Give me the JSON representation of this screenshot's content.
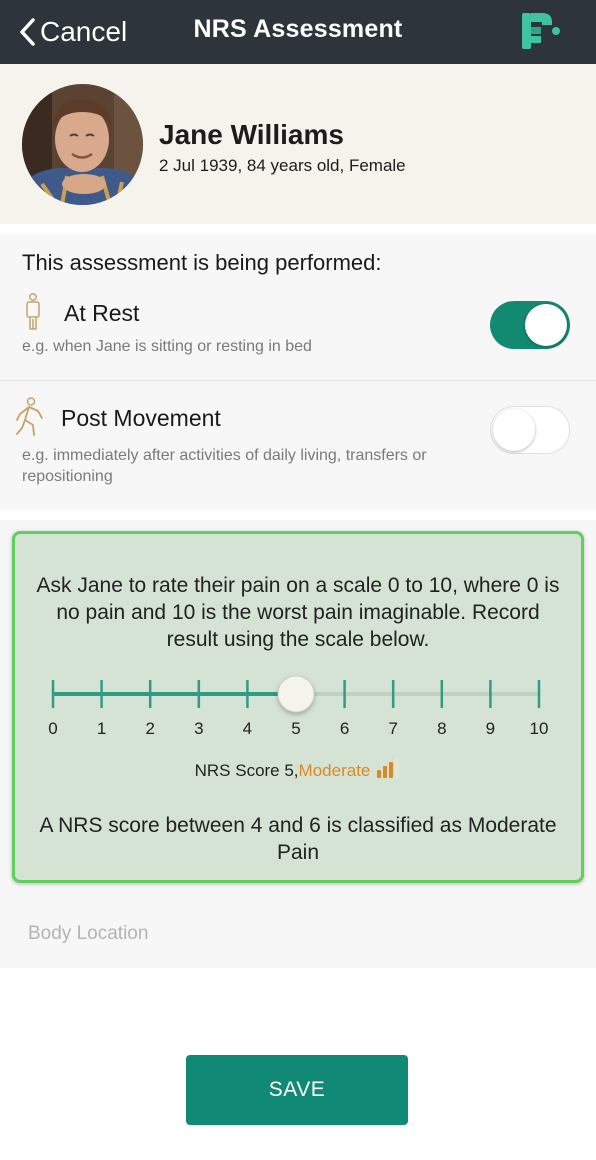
{
  "header": {
    "cancel_label": "Cancel",
    "title": "NRS Assessment",
    "logo_icon": "app-logo-icon",
    "bg_color": "#2d343b"
  },
  "patient": {
    "name": "Jane Williams",
    "details": "2 Jul 1939, 84 years old, Female",
    "avatar_icon": "patient-photo"
  },
  "assessment_context": {
    "heading": "This assessment is being performed:",
    "options": [
      {
        "label": "At Rest",
        "description": "e.g. when Jane is sitting or resting in bed",
        "icon": "standing-person-icon",
        "enabled": true
      },
      {
        "label": "Post Movement",
        "description": "e.g. immediately after activities of daily living, transfers or repositioning",
        "icon": "walking-person-icon",
        "enabled": false
      }
    ]
  },
  "nrs": {
    "instruction": "Ask Jane to rate their pain on a scale 0 to 10, where 0 is no pain and 10 is the worst pain imaginable. Record result using the scale below.",
    "scale_min": 0,
    "scale_max": 10,
    "value": 5,
    "ticks": [
      "0",
      "1",
      "2",
      "3",
      "4",
      "5",
      "6",
      "7",
      "8",
      "9",
      "10"
    ],
    "score_prefix": "NRS Score 5,",
    "score_level": "Moderate",
    "level_color": "#d98a25",
    "level_bars_filled": 3,
    "level_bars_total": 4,
    "classification": "A NRS score between 4 and 6 is classified as Moderate Pain",
    "accent_color": "#2f9c83",
    "border_color": "#5fd05a"
  },
  "body_location": {
    "placeholder": "Body Location"
  },
  "save": {
    "label": "SAVE",
    "color": "#108a74"
  }
}
